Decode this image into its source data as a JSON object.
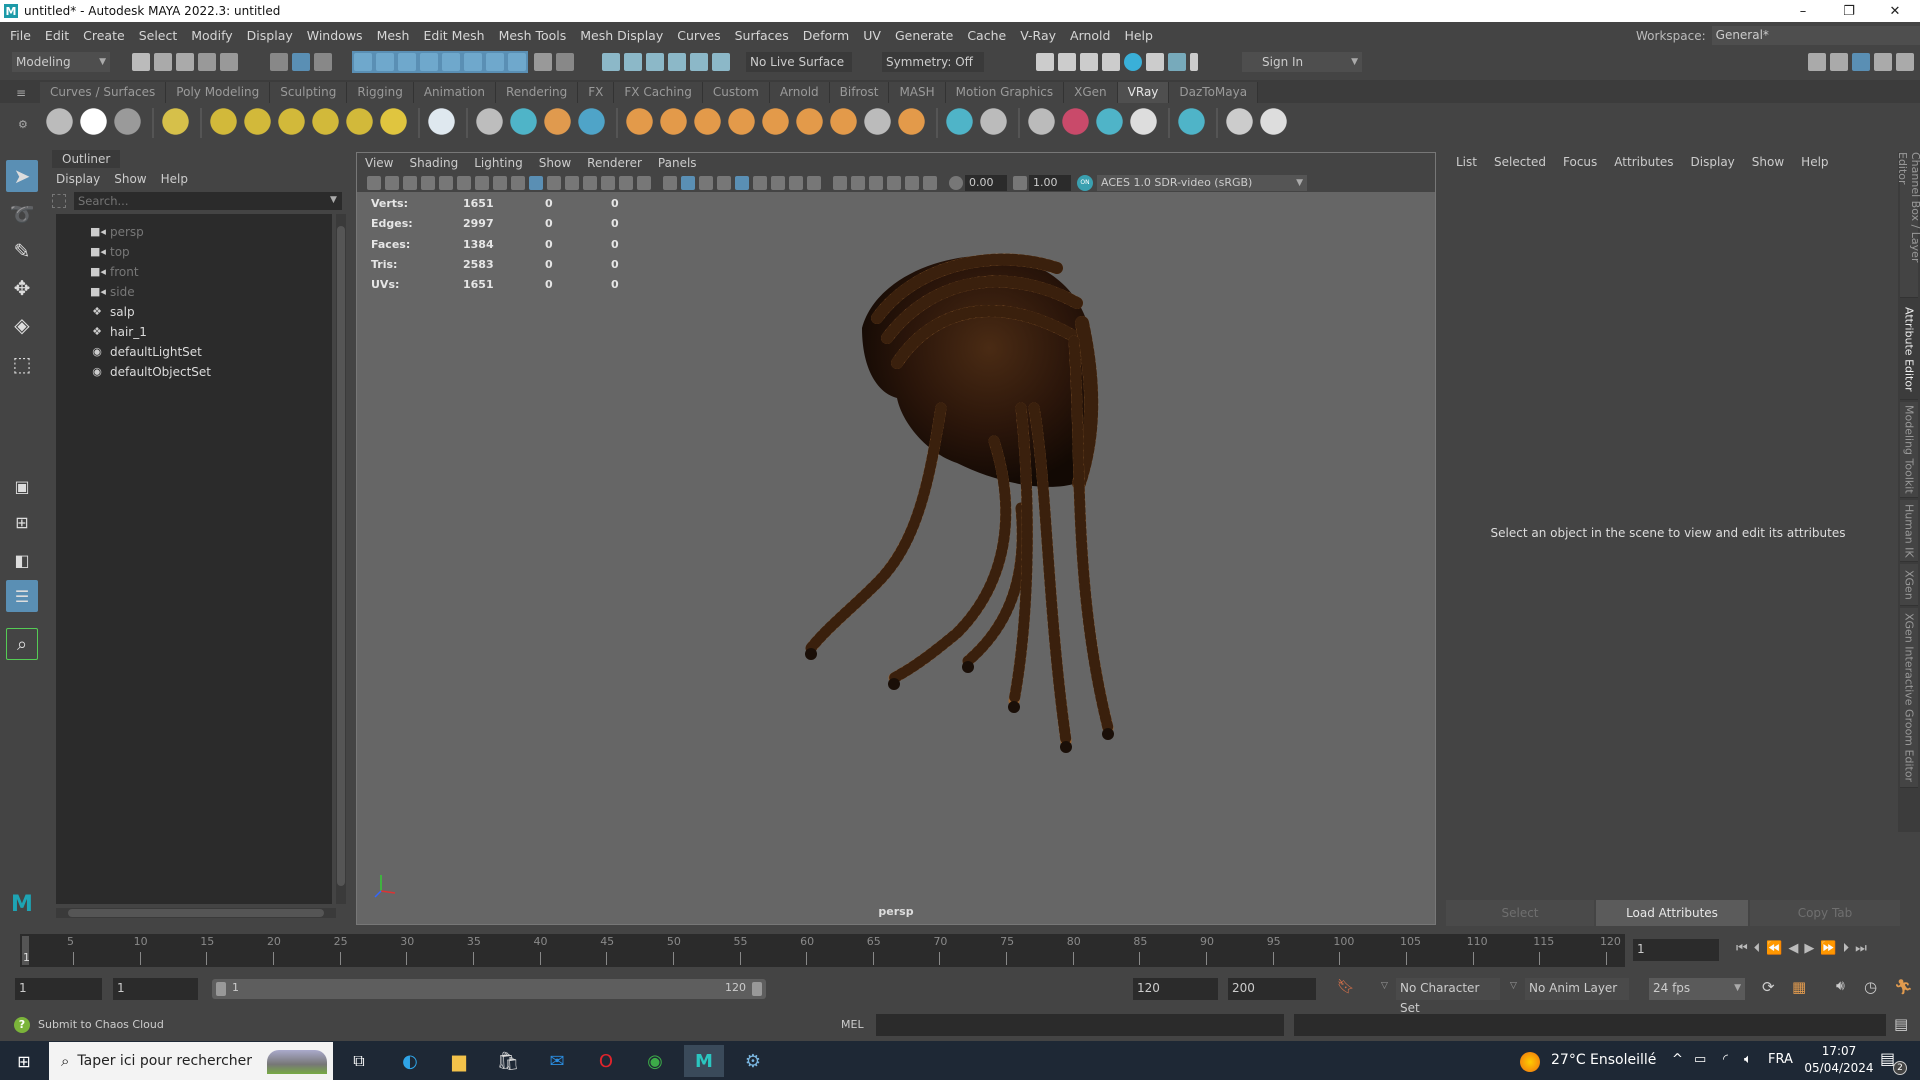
{
  "window": {
    "title": "untitled* - Autodesk MAYA 2022.3: untitled",
    "logo_letter": "M",
    "minimize": "–",
    "maximize": "❐",
    "close": "✕"
  },
  "menu": [
    "File",
    "Edit",
    "Create",
    "Select",
    "Modify",
    "Display",
    "Windows",
    "Mesh",
    "Edit Mesh",
    "Mesh Tools",
    "Mesh Display",
    "Curves",
    "Surfaces",
    "Deform",
    "UV",
    "Generate",
    "Cache",
    "V-Ray",
    "Arnold",
    "Help"
  ],
  "workspace": {
    "label": "Workspace:",
    "value": "General*"
  },
  "statusline": {
    "mode": "Modeling",
    "live_surface": "No Live Surface",
    "symmetry": "Symmetry: Off",
    "sign_in": "Sign In"
  },
  "shelf": {
    "tabs": [
      "Curves / Surfaces",
      "Poly Modeling",
      "Sculpting",
      "Rigging",
      "Animation",
      "Rendering",
      "FX",
      "FX Caching",
      "Custom",
      "Arnold",
      "Bifrost",
      "MASH",
      "Motion Graphics",
      "XGen",
      "VRay",
      "DazToMaya"
    ],
    "active": "VRay",
    "icons": [
      {
        "name": "vray-asset-editor-icon",
        "color": "#bbbbbb"
      },
      {
        "name": "vray-render-icon",
        "color": "#ffffff"
      },
      {
        "name": "vray-ipr-icon",
        "color": "#9a9a9a"
      },
      "sep",
      {
        "name": "vray-log-icon",
        "color": "#d6c04a"
      },
      "sep",
      {
        "name": "dome-light-icon",
        "color": "#d2b93a"
      },
      {
        "name": "rect-light-icon",
        "color": "#d2b93a"
      },
      {
        "name": "sphere-light-icon",
        "color": "#d2b93a"
      },
      {
        "name": "mesh-light-icon",
        "color": "#d2b93a"
      },
      {
        "name": "ies-light-icon",
        "color": "#d2b93a"
      },
      {
        "name": "sun-light-icon",
        "color": "#e0c53f"
      },
      "sep",
      {
        "name": "physical-camera-icon",
        "color": "#dfe8ef"
      },
      "sep",
      {
        "name": "proxy-create-icon",
        "color": "#bdbdbd"
      },
      {
        "name": "proxy-export-icon",
        "color": "#4fb4c8"
      },
      {
        "name": "scene-export-icon",
        "color": "#e09a4e"
      },
      {
        "name": "volume-grid-icon",
        "color": "#4fa4c8"
      },
      "sep",
      {
        "name": "fur-icon",
        "color": "#e39a4a"
      },
      {
        "name": "plane-icon",
        "color": "#e39a4a"
      },
      {
        "name": "grass-icon",
        "color": "#e39a4a"
      },
      {
        "name": "decal-icon",
        "color": "#e39a4a"
      },
      {
        "name": "tile-icon",
        "color": "#e39a4a"
      },
      {
        "name": "instancer-icon",
        "color": "#e39a4a"
      },
      {
        "name": "clipper-icon",
        "color": "#e39a4a"
      },
      {
        "name": "toon-icon",
        "color": "#bbbbbb"
      },
      {
        "name": "settings-gear-icon",
        "color": "#e39a4a"
      },
      "sep",
      {
        "name": "material-icon",
        "color": "#4fb4c8"
      },
      {
        "name": "material-assign-icon",
        "color": "#bbbbbb"
      },
      "sep",
      {
        "name": "file-import-icon",
        "color": "#bbbbbb"
      },
      {
        "name": "color-sphere-icon",
        "color": "#c94a6a"
      },
      {
        "name": "multi-sphere-icon",
        "color": "#4fb4c8"
      },
      {
        "name": "palette-icon",
        "color": "#dddddd"
      },
      "sep",
      {
        "name": "frame-buffer-icon",
        "color": "#4fb4c8"
      },
      "sep",
      {
        "name": "plugin-icon",
        "color": "#cccccc"
      },
      {
        "name": "vray-logo-icon",
        "color": "#dddddd"
      }
    ]
  },
  "outliner": {
    "title": "Outliner",
    "menu": [
      "Display",
      "Show",
      "Help"
    ],
    "search_placeholder": "Search...",
    "items": [
      {
        "label": "persp",
        "icon": "camera-icon",
        "dim": true
      },
      {
        "label": "top",
        "icon": "camera-icon",
        "dim": true
      },
      {
        "label": "front",
        "icon": "camera-icon",
        "dim": true
      },
      {
        "label": "side",
        "icon": "camera-icon",
        "dim": true
      },
      {
        "label": "salp",
        "icon": "transform-icon",
        "dim": false
      },
      {
        "label": "hair_1",
        "icon": "transform-icon",
        "dim": false
      },
      {
        "label": "defaultLightSet",
        "icon": "set-icon",
        "dim": false
      },
      {
        "label": "defaultObjectSet",
        "icon": "set-icon",
        "dim": false
      }
    ]
  },
  "viewport": {
    "menu": [
      "View",
      "Shading",
      "Lighting",
      "Show",
      "Renderer",
      "Panels"
    ],
    "hud": [
      {
        "label": "Verts:",
        "value": "1651",
        "a": "0",
        "b": "0"
      },
      {
        "label": "Edges:",
        "value": "2997",
        "a": "0",
        "b": "0"
      },
      {
        "label": "Faces:",
        "value": "1384",
        "a": "0",
        "b": "0"
      },
      {
        "label": "Tris:",
        "value": "2583",
        "a": "0",
        "b": "0"
      },
      {
        "label": "UVs:",
        "value": "1651",
        "a": "0",
        "b": "0"
      }
    ],
    "exposure": "0.00",
    "gamma": "1.00",
    "color_management": "ON",
    "color_space": "ACES 1.0 SDR-video (sRGB)",
    "camera": "persp",
    "hair_colors": {
      "light": "#9a6533",
      "dark": "#3a200d",
      "cap": "#2a150a"
    }
  },
  "attribute_editor": {
    "menu": [
      "List",
      "Selected",
      "Focus",
      "Attributes",
      "Display",
      "Show",
      "Help"
    ],
    "message": "Select an object in the scene to view and edit its attributes",
    "buttons": [
      "Select",
      "Load Attributes",
      "Copy Tab"
    ]
  },
  "side_tabs": [
    "Channel Box / Layer Editor",
    "Attribute Editor",
    "Modeling Toolkit",
    "Human IK",
    "XGen",
    "XGen Interactive Groom Editor"
  ],
  "timeline": {
    "start_label": "1",
    "ticks": [
      5,
      10,
      15,
      20,
      25,
      30,
      35,
      40,
      45,
      50,
      55,
      60,
      65,
      70,
      75,
      80,
      85,
      90,
      95,
      100,
      105,
      110,
      115,
      120
    ],
    "current_frame": "1"
  },
  "range": {
    "anim_start": "1",
    "start": "1",
    "slider_start": "1",
    "slider_end": "120",
    "end": "120",
    "anim_end": "200",
    "character_set": "No Character Set",
    "anim_layer": "No Anim Layer",
    "fps": "24 fps"
  },
  "command": {
    "status": "Submit to Chaos Cloud",
    "language": "MEL"
  },
  "taskbar": {
    "search_placeholder": "Taper ici pour rechercher",
    "temperature": "27°C",
    "weather": "Ensoleillé",
    "language": "FRA",
    "time": "17:07",
    "date": "05/04/2024",
    "notifications": "2"
  }
}
